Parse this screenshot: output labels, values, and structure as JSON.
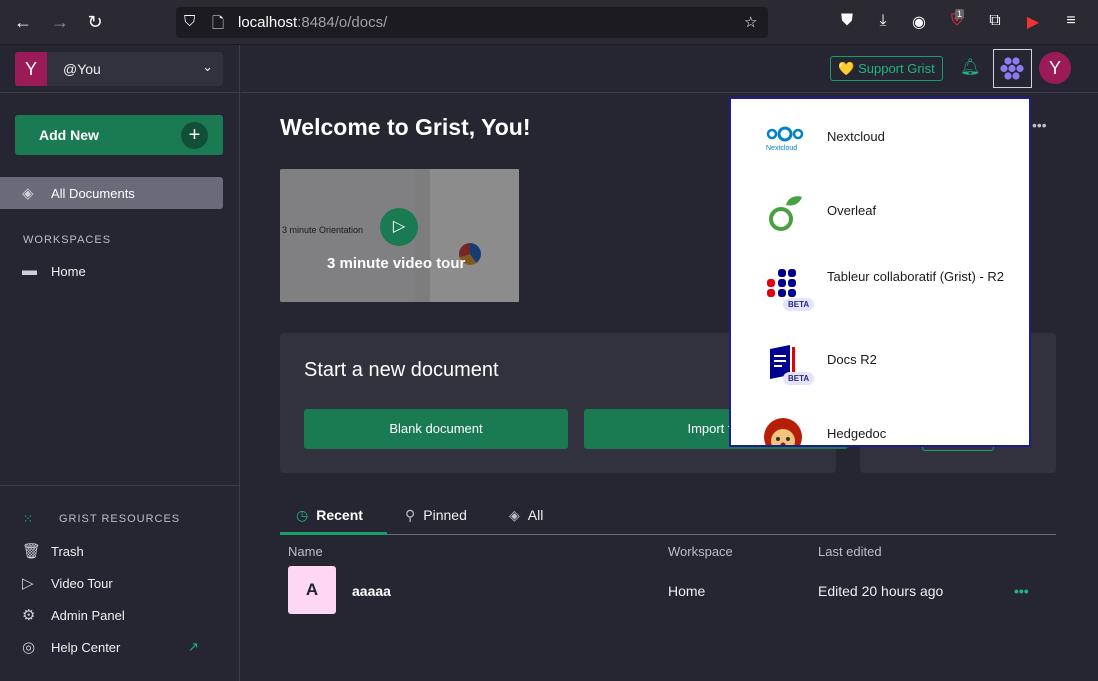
{
  "browser": {
    "url_host": "localhost",
    "url_rest": ":8484/o/docs/",
    "badge_count": "1"
  },
  "sidebar": {
    "org_avatar": "Y",
    "org_name": "@You",
    "add_new_label": "Add New",
    "all_documents_label": "All Documents",
    "workspaces_header": "WORKSPACES",
    "workspace_home": "Home",
    "resources_header": "GRIST RESOURCES",
    "resources": [
      {
        "label": "Trash",
        "icon": "trash-icon"
      },
      {
        "label": "Video Tour",
        "icon": "video-icon"
      },
      {
        "label": "Admin Panel",
        "icon": "gear-icon"
      },
      {
        "label": "Help Center",
        "icon": "help-icon"
      }
    ]
  },
  "topbar": {
    "support_label": "💛 Support Grist",
    "user_avatar": "Y"
  },
  "main": {
    "welcome": "Welcome to Grist, You!",
    "video_caption": "3 minute video tour",
    "video_thumb_text": "3 minute Orientation",
    "new_doc_title": "Start a new document",
    "blank_doc_label": "Blank document",
    "import_label": "Import file",
    "tabs": [
      "Recent",
      "Pinned",
      "All"
    ],
    "columns": [
      "Name",
      "Workspace",
      "Last edited"
    ],
    "rows": [
      {
        "initial": "A",
        "name": "aaaaa",
        "workspace": "Home",
        "edited": "Edited 20 hours ago"
      }
    ]
  },
  "apps_menu": {
    "items": [
      {
        "name": "Nextcloud",
        "logo_text": "Nextcloud"
      },
      {
        "name": "Overleaf"
      },
      {
        "name": "Tableur collaboratif (Grist) - R2",
        "badge": "BETA"
      },
      {
        "name": "Docs R2",
        "badge": "BETA"
      },
      {
        "name": "Hedgedoc"
      }
    ]
  },
  "colors": {
    "accent": "#1a7a52",
    "accent_light": "#1fb57a",
    "avatar": "#9a1b57",
    "background": "#262633"
  }
}
